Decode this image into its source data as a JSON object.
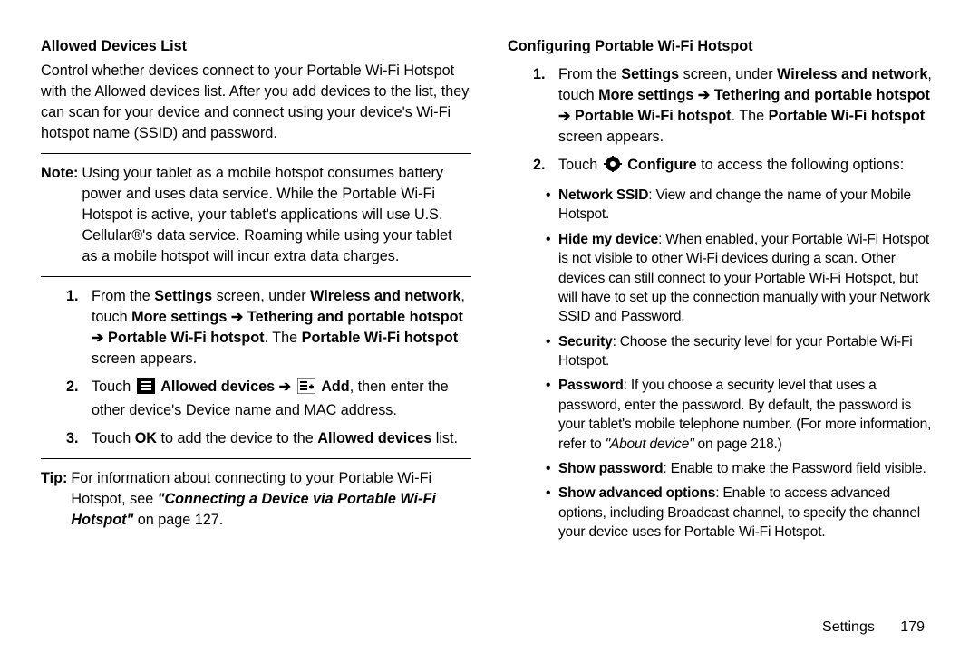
{
  "left": {
    "heading": "Allowed Devices List",
    "intro": "Control whether devices connect to your Portable Wi-Fi Hotspot with the Allowed devices list. After you add devices to the list, they can scan for your device and connect using your device's Wi-Fi hotspot name (SSID) and password.",
    "note_label": "Note:",
    "note_body": "Using your tablet as a mobile hotspot consumes battery power and uses data service. While the Portable Wi-Fi Hotspot is active, your tablet's applications will use U.S. Cellular®'s data service. Roaming while using your tablet as a mobile hotspot will incur extra data charges.",
    "step1": {
      "num": "1.",
      "pre": "From the ",
      "settings": "Settings",
      "mid1": " screen, under ",
      "wireless": "Wireless and network",
      "mid2": ", touch ",
      "more": "More settings ➔ Tethering and portable hotspot ➔ Portable Wi-Fi hotspot",
      "mid3": ". The ",
      "pwh": "Portable Wi-Fi hotspot",
      "tail": " screen appears."
    },
    "step2": {
      "num": "2.",
      "pre": "Touch ",
      "allowed": "Allowed devices ➔",
      "add": "Add",
      "tail": ", then enter the other device's Device name and MAC address."
    },
    "step3": {
      "num": "3.",
      "pre": "Touch ",
      "ok": "OK",
      "mid": " to add the device to the ",
      "list": "Allowed devices",
      "tail": " list."
    },
    "tip_label": "Tip:",
    "tip_pre": "For information about connecting to your Portable Wi-Fi Hotspot, see ",
    "tip_link": "\"Connecting a Device via Portable Wi-Fi Hotspot\"",
    "tip_tail": " on page 127."
  },
  "right": {
    "heading": "Configuring Portable Wi-Fi Hotspot",
    "step1": {
      "num": "1.",
      "pre": "From the ",
      "settings": "Settings",
      "mid1": " screen, under ",
      "wireless": "Wireless and network",
      "mid2": ", touch ",
      "more": "More settings ➔ Tethering and portable hotspot ➔ Portable Wi-Fi hotspot",
      "mid3": ". The ",
      "pwh": "Portable Wi-Fi hotspot",
      "tail": " screen appears."
    },
    "step2": {
      "num": "2.",
      "pre": "Touch ",
      "configure": "Configure",
      "tail": " to access the following options:"
    },
    "b1": {
      "label": "Network SSID",
      "text": ": View and change the name of your Mobile Hotspot."
    },
    "b2": {
      "label": "Hide my device",
      "text": ": When enabled, your Portable Wi-Fi Hotspot is not visible to other Wi-Fi devices during a scan. Other devices can still connect to your Portable Wi-Fi Hotspot, but  will have to set up the connection manually with your Network SSID and Password."
    },
    "b3": {
      "label": "Security",
      "text": ": Choose the security level for your Portable Wi-Fi Hotspot."
    },
    "b4": {
      "label": "Password",
      "text": ": If you choose a security level that uses a password, enter the password. By default, the password is your tablet's mobile telephone number. (For more information, refer to ",
      "ref": "\"About device\"",
      "ref_tail": " on page 218.)"
    },
    "b5": {
      "label": "Show password",
      "text": ": Enable to make the Password field visible."
    },
    "b6": {
      "label": "Show advanced options",
      "text": ": Enable to access advanced options, including Broadcast channel, to specify the channel your device uses for Portable Wi-Fi Hotspot."
    }
  },
  "footer": {
    "section": "Settings",
    "page": "179"
  }
}
